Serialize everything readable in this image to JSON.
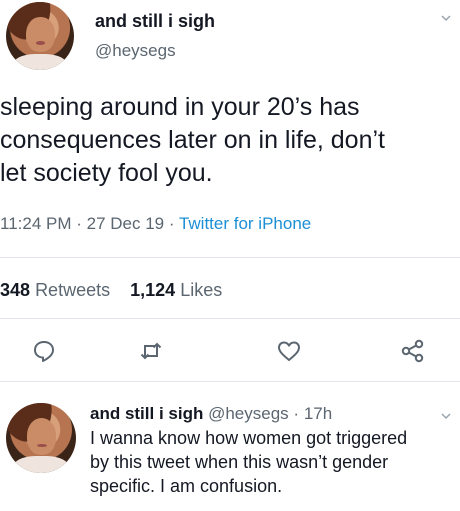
{
  "tweet": {
    "display_name": "and still i sigh",
    "handle": "@heysegs",
    "text": "sleeping around in your 20’s has\nconsequences later on in life, don’t\nlet society fool you.",
    "time": "11:24 PM",
    "date": "27 Dec 19",
    "source": "Twitter for iPhone",
    "retweets_count": "348",
    "retweets_label": "Retweets",
    "likes_count": "1,124",
    "likes_label": "Likes"
  },
  "actions": [
    {
      "icon": "reply-icon"
    },
    {
      "icon": "retweet-icon"
    },
    {
      "icon": "like-icon"
    },
    {
      "icon": "share-icon"
    }
  ],
  "reply": {
    "display_name": "and still i sigh",
    "handle": "@heysegs",
    "age": "17h",
    "text": "I wanna know how women got triggered\nby this tweet when this wasn’t gender\nspecific. I am confusion."
  },
  "colors": {
    "text": "#141823",
    "secondary": "#5b6670",
    "link": "#1d8fd6",
    "divider": "#e2e6ea"
  }
}
